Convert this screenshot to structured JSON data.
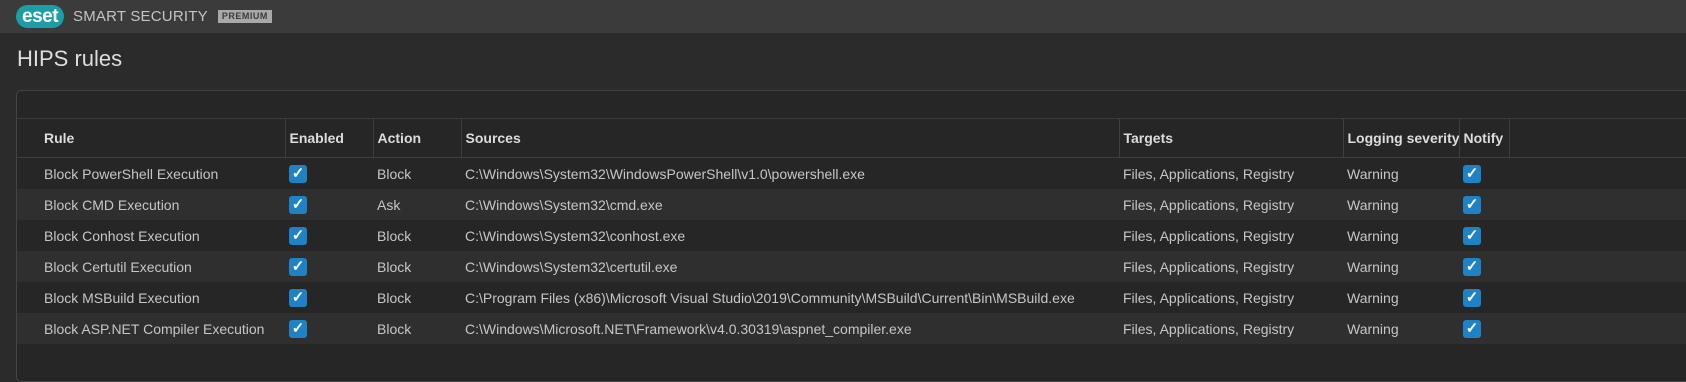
{
  "app": {
    "logo_text": "eset",
    "product_name": "SMART SECURITY",
    "edition_badge": "PREMIUM"
  },
  "page": {
    "title": "HIPS rules"
  },
  "table": {
    "columns": [
      "Rule",
      "Enabled",
      "Action",
      "Sources",
      "Targets",
      "Logging severity",
      "Notify"
    ],
    "rows": [
      {
        "rule": "Block PowerShell Execution",
        "enabled": true,
        "action": "Block",
        "sources": "C:\\Windows\\System32\\WindowsPowerShell\\v1.0\\powershell.exe",
        "targets": "Files, Applications, Registry",
        "logging": "Warning",
        "notify": true
      },
      {
        "rule": "Block CMD Execution",
        "enabled": true,
        "action": "Ask",
        "sources": "C:\\Windows\\System32\\cmd.exe",
        "targets": "Files, Applications, Registry",
        "logging": "Warning",
        "notify": true
      },
      {
        "rule": "Block Conhost Execution",
        "enabled": true,
        "action": "Block",
        "sources": "C:\\Windows\\System32\\conhost.exe",
        "targets": "Files, Applications, Registry",
        "logging": "Warning",
        "notify": true
      },
      {
        "rule": "Block Certutil Execution",
        "enabled": true,
        "action": "Block",
        "sources": "C:\\Windows\\System32\\certutil.exe",
        "targets": "Files, Applications, Registry",
        "logging": "Warning",
        "notify": true
      },
      {
        "rule": "Block MSBuild Execution",
        "enabled": true,
        "action": "Block",
        "sources": "C:\\Program Files (x86)\\Microsoft Visual Studio\\2019\\Community\\MSBuild\\Current\\Bin\\MSBuild.exe",
        "targets": "Files, Applications, Registry",
        "logging": "Warning",
        "notify": true
      },
      {
        "rule": "Block ASP.NET Compiler Execution",
        "enabled": true,
        "action": "Block",
        "sources": "C:\\Windows\\Microsoft.NET\\Framework\\v4.0.30319\\aspnet_compiler.exe",
        "targets": "Files, Applications, Registry",
        "logging": "Warning",
        "notify": true
      }
    ]
  },
  "colors": {
    "accent": "#1e82c4",
    "brand": "#1c9ea9"
  }
}
